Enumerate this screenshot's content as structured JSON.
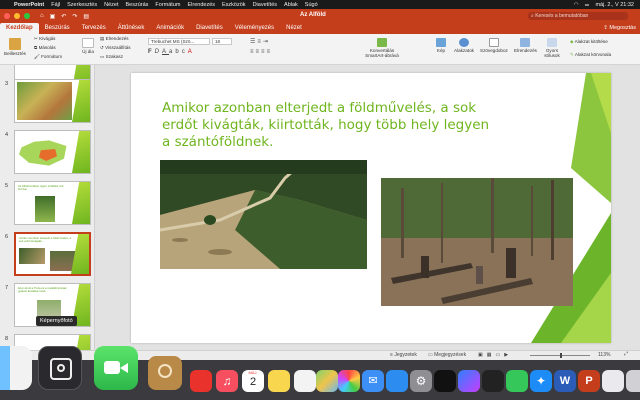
{
  "menubar": {
    "app_name": "PowerPoint",
    "items": [
      "Fájl",
      "Szerkesztés",
      "Nézet",
      "Beszúrás",
      "Formátum",
      "Elrendezés",
      "Eszközök",
      "Diavetítés",
      "Ablak",
      "Súgó"
    ],
    "datetime": "máj. 2., V  21:32"
  },
  "titlebar": {
    "title": "Az Alföld",
    "search_placeholder": "Keresés a bemutatóban"
  },
  "ribbon_tabs": [
    "Kezdőlap",
    "Beszúrás",
    "Tervezés",
    "Áttűnések",
    "Animációk",
    "Diavetítés",
    "Véleményezés",
    "Nézet"
  ],
  "share_label": "Megosztás",
  "ribbon": {
    "paste": "Beillesztés",
    "cut": "Kivágás",
    "copy": "Másolás",
    "format_painter": "Formátum",
    "new_slide": "Új dia",
    "layout": "Elrendezés",
    "reset": "Visszaállítás",
    "section": "Szakasz",
    "font_name": "Trebuchet MS (Szö...",
    "font_size": "18",
    "convert_smartart": "Konvertálás SmartArt-ábrává",
    "picture": "Kép",
    "shapes": "Alakzatok",
    "textbox": "Szövegdoboz",
    "arrange": "Elrendezés",
    "quick_styles": "Gyors stílusok",
    "shape_fill": "Alakzat kitöltése",
    "shape_outline": "Alakzat körvonala"
  },
  "thumbnails": [
    {
      "num": "3"
    },
    {
      "num": "4"
    },
    {
      "num": "5",
      "text": "Az Alföld területe régen erdőkkel volt borítva."
    },
    {
      "num": "6",
      "text": "Amikor azonban elterjedt a földművelés, a sok erdőt kivágták..."
    },
    {
      "num": "7",
      "text": "Ezen kívül a Tisza és a mellékfolyóinak gyakori áradásai miatt..."
    },
    {
      "num": "8"
    }
  ],
  "tooltip": "Képernyőfotó",
  "slide": {
    "heading": "Amikor azonban elterjedt a földművelés, a sok erdőt kivágták, kiirtották, hogy több hely legyen a szántóföldnek."
  },
  "statusbar": {
    "notes": "Jegyzetek",
    "comments": "Megjegyzések",
    "zoom": "113%"
  },
  "dock": {
    "calendar_month": "MÁJ.",
    "calendar_day": "2"
  },
  "colors": {
    "accent": "#c43e1c",
    "heading_green": "#6fb51f"
  }
}
